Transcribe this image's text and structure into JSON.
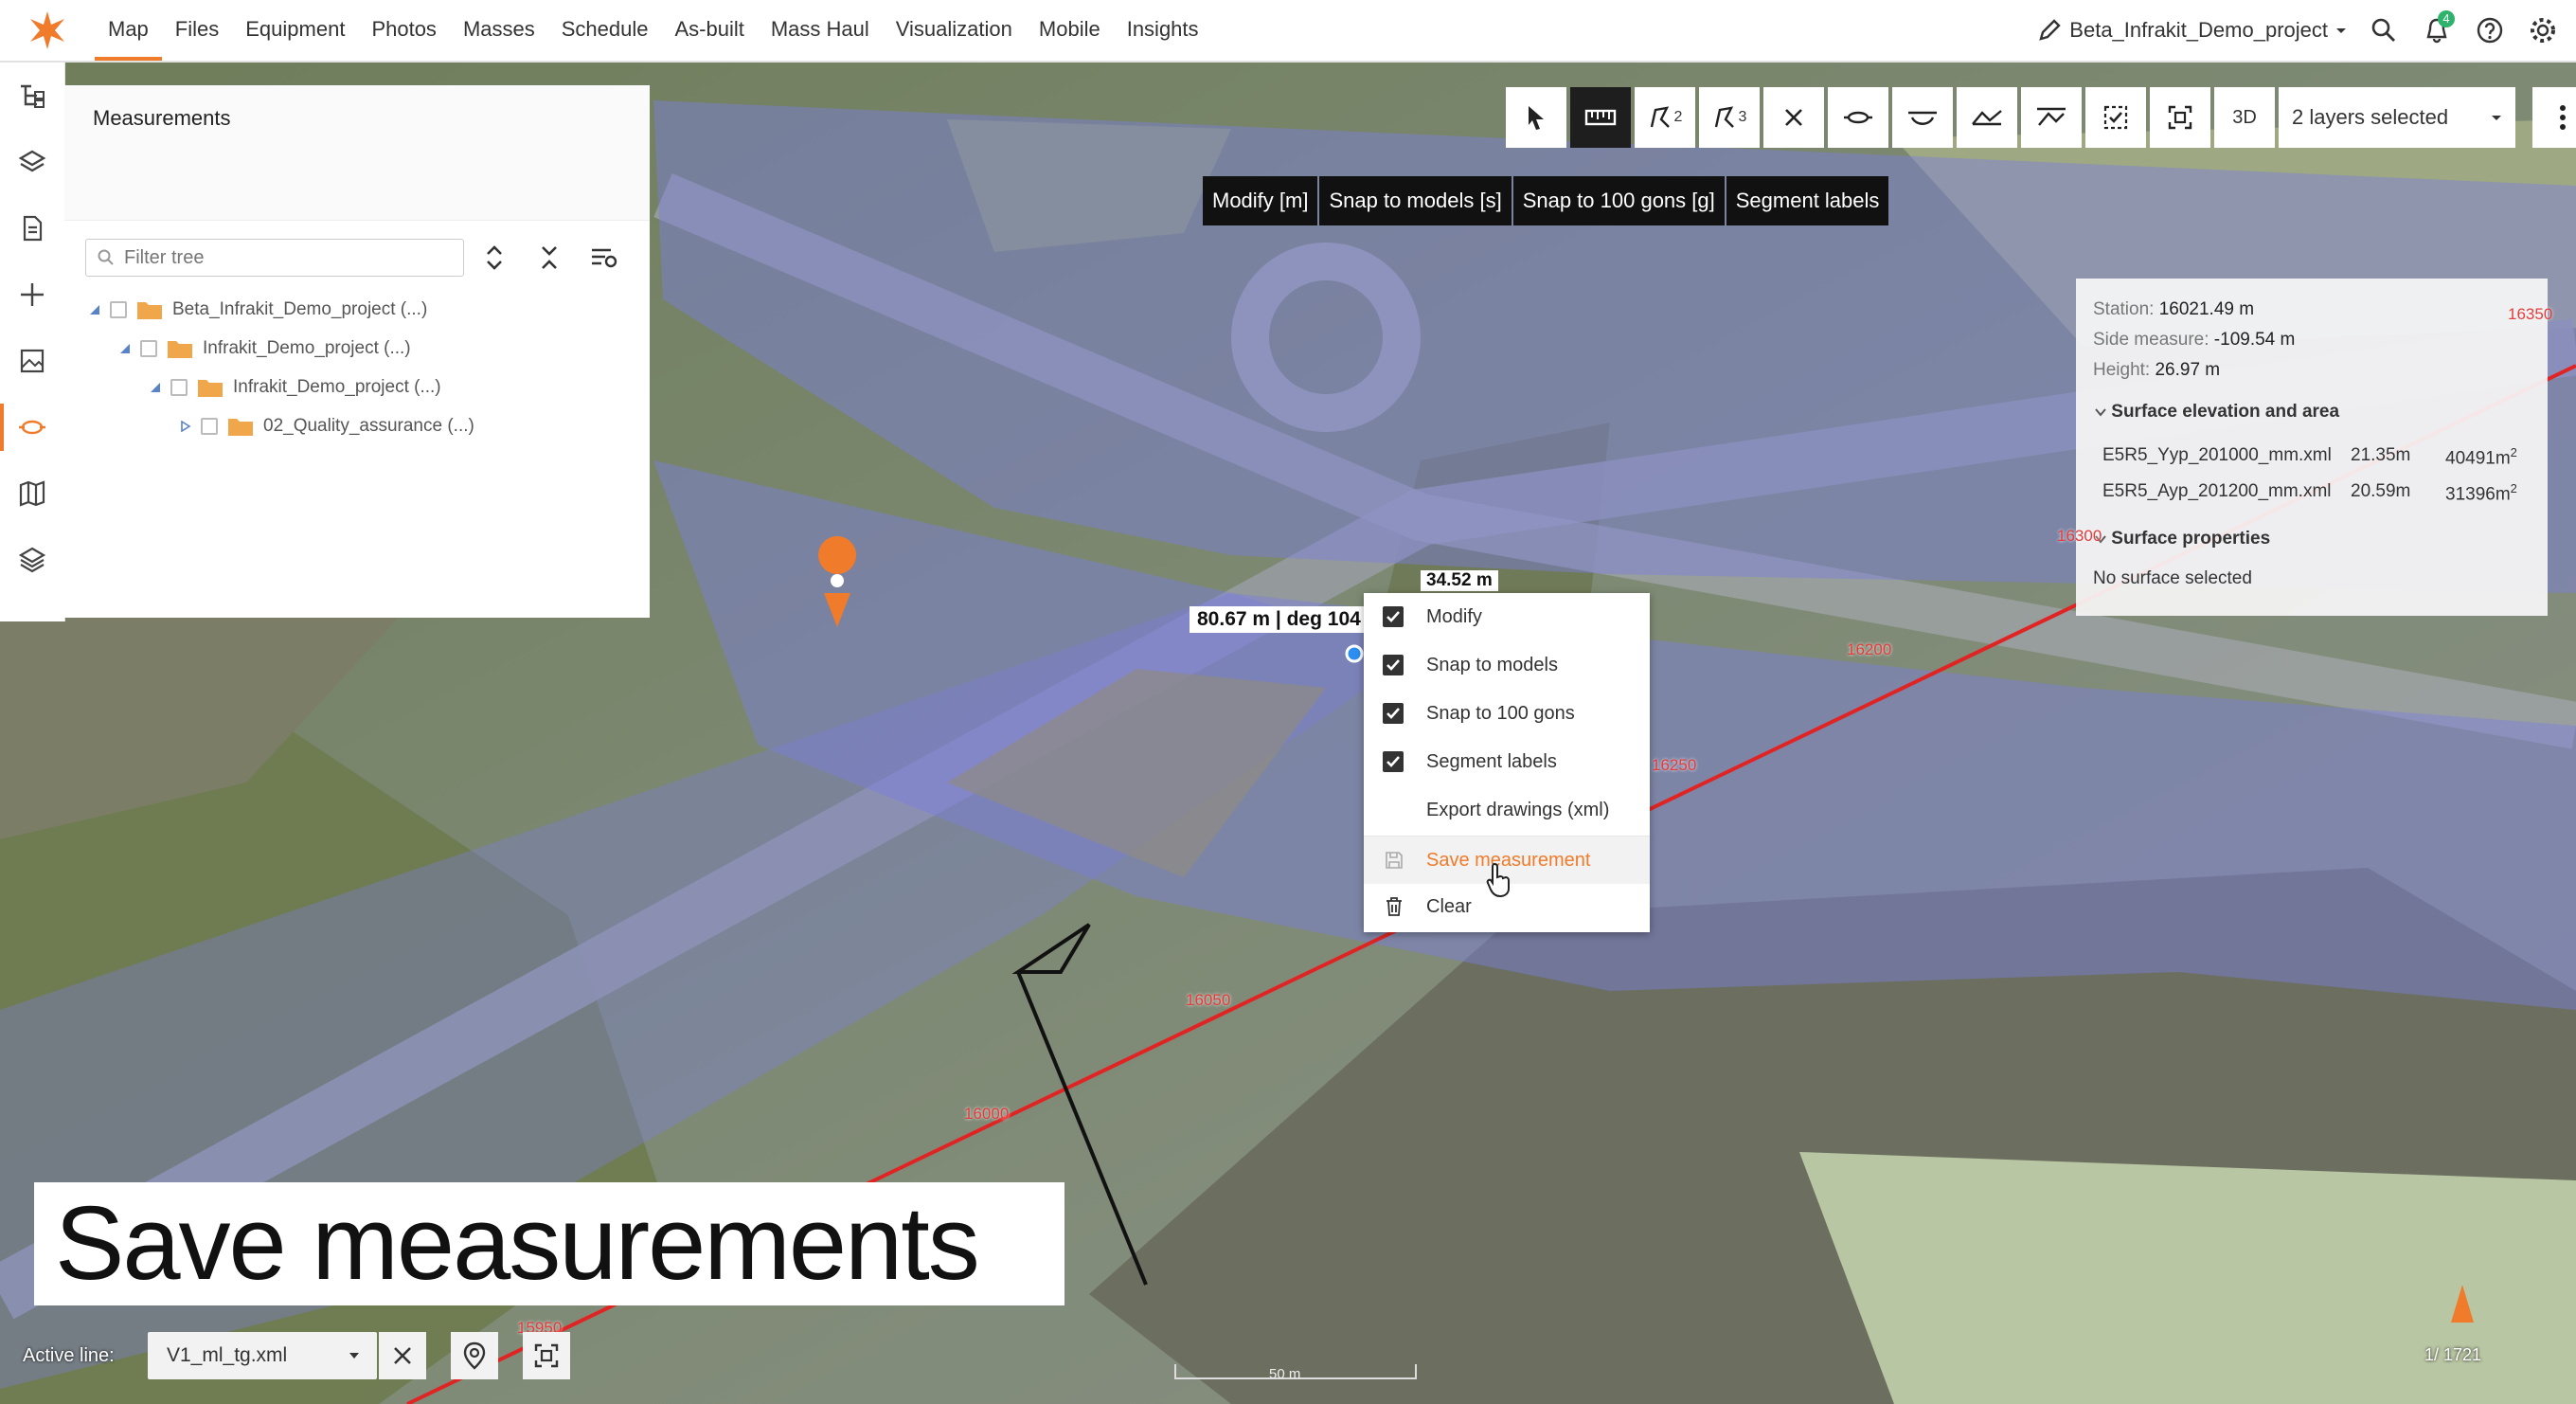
{
  "nav": {
    "items": [
      "Map",
      "Files",
      "Equipment",
      "Photos",
      "Masses",
      "Schedule",
      "As-built",
      "Mass Haul",
      "Visualization",
      "Mobile",
      "Insights"
    ],
    "active": "Map",
    "project": "Beta_Infrakit_Demo_project",
    "notifications": "4"
  },
  "panel": {
    "title": "Measurements",
    "filter_placeholder": "Filter tree",
    "tree": [
      {
        "label": "Beta_Infrakit_Demo_project (...)"
      },
      {
        "label": "Infrakit_Demo_project (...)"
      },
      {
        "label": "Infrakit_Demo_project (...)"
      },
      {
        "label": "02_Quality_assurance (...)"
      }
    ]
  },
  "toolbar": {
    "draw2_sub": "2",
    "draw3_sub": "3",
    "mode_3d": "3D",
    "layers": "2 layers selected"
  },
  "hotkeys": [
    "Modify [m]",
    "Snap to models [s]",
    "Snap to 100 gons [g]",
    "Segment labels"
  ],
  "info": {
    "station_label": "Station:",
    "station_value": "16021.49 m",
    "side_label": "Side measure:",
    "side_value": "-109.54 m",
    "height_label": "Height:",
    "height_value": "26.97 m",
    "surface_elev_title": "Surface elevation and area",
    "surfaces": [
      {
        "name": "E5R5_Yyp_201000_mm.xml",
        "elev": "21.35m",
        "area": "40491m",
        "sup": "2"
      },
      {
        "name": "E5R5_Ayp_201200_mm.xml",
        "elev": "20.59m",
        "area": "31396m",
        "sup": "2"
      }
    ],
    "surface_props_title": "Surface properties",
    "no_surface": "No surface selected"
  },
  "menu": {
    "items": [
      {
        "label": "Modify",
        "checked": true
      },
      {
        "label": "Snap to models",
        "checked": true
      },
      {
        "label": "Snap to 100 gons",
        "checked": true
      },
      {
        "label": "Segment labels",
        "checked": true
      },
      {
        "label": "Export drawings (xml)",
        "checked": false
      },
      {
        "label": "Save measurement",
        "checked": false
      },
      {
        "label": "Clear",
        "checked": false
      }
    ]
  },
  "map_labels": {
    "segment": "34.52 m",
    "distance": "80.67 m | deg 104",
    "stations": [
      "16200",
      "16250",
      "16050",
      "16000",
      "15950",
      "16350",
      "16300"
    ]
  },
  "caption": "Save measurements",
  "bottom": {
    "active_line_label": "Active line:",
    "active_line_value": "V1_ml_tg.xml",
    "scale": "50 m",
    "page": "1/ 1721"
  },
  "colors": {
    "accent": "#f07b2a",
    "overlay": "#7a7fe0",
    "alignment": "#e02424"
  }
}
